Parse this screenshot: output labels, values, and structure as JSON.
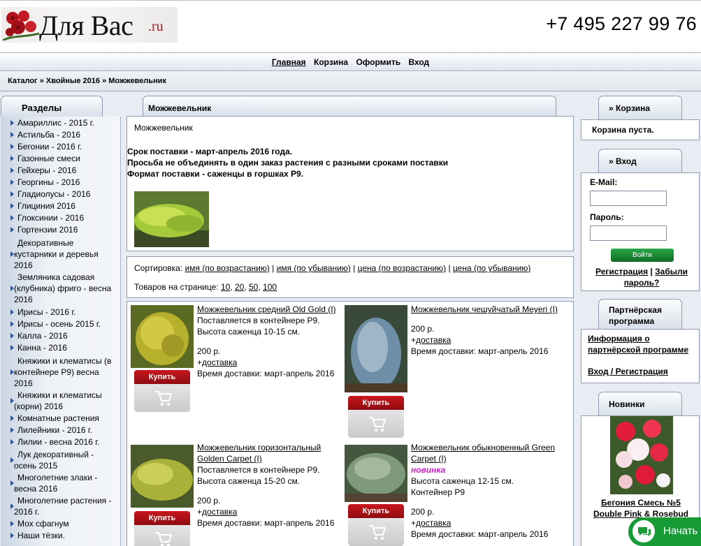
{
  "header": {
    "brand": "Для Вас",
    "tld": ".ru",
    "phone": "+7 495 227 99 76"
  },
  "nav": {
    "items": [
      "Главная",
      "Корзина",
      "Оформить",
      "Вход"
    ]
  },
  "breadcrumb": {
    "items": [
      "Каталог",
      "Хвойные 2016",
      "Можжевельник"
    ],
    "sep": "»"
  },
  "sidebar": {
    "title": "Разделы",
    "items": [
      "Амариллис - 2015 г.",
      "Астильба - 2016",
      "Бегонии - 2016 г.",
      "Газонные смеси",
      "Гейхеры - 2016",
      "Георгины - 2016",
      "Гладиолусы - 2016",
      "Глициния 2016",
      "Глоксинии - 2016",
      "Гортензии 2016",
      "Декоративные кустарники и деревья 2016",
      "Земляника садовая (клубника) фриго - весна 2016",
      "Ирисы - 2016 г.",
      "Ирисы - осень 2015 г.",
      "Калла - 2016",
      "Канна - 2016",
      "Княжики и клематисы (в контейнере Р9) весна 2016",
      "Княжики и клематисы (корни) 2016",
      "Комнатные растения",
      "Лилейники - 2016 г.",
      "Лилии - весна 2016 г.",
      "Лук декоративный - осень 2015",
      "Многолетние злаки - весна 2016",
      "Многолетние растения - 2016 г.",
      "Мох сфагнум",
      "Наши тёзки."
    ]
  },
  "category": {
    "title": "Можжевельник",
    "subtitle": "Можжевельник",
    "notes": [
      "Срок поставки - март-апрель 2016 года.",
      "Просьба не объединять в один заказ растения с разными сроками поставки",
      "Формат поставки - саженцы в горшках Р9."
    ]
  },
  "sort": {
    "label": "Сортировка:",
    "options": [
      "имя (по возрастанию)",
      "имя (по убыванию)",
      "цена (по возрастанию)",
      "цена (по убыванию)"
    ],
    "perpage_label": "Товаров на странице:",
    "perpage": [
      "10",
      "20",
      "50",
      "100"
    ]
  },
  "products": [
    {
      "title": "Можжевельник средний Old Gold (I)",
      "lines": [
        "Поставляется в контейнере Р9.",
        "Высота саженца 10-15 см."
      ],
      "price": "200 р.",
      "delivery_link": "доставка",
      "delivery_time": "Время доставки:  март-апрель 2016",
      "buy": "Купить"
    },
    {
      "title": "Можжевельник чешуйчатый Meyeri (I)",
      "lines": [],
      "price": "200 р.",
      "delivery_link": "доставка",
      "delivery_time": "Время доставки:  март-апрель 2016",
      "buy": "Купить"
    },
    {
      "title": "Можжевельник горизонтальный Golden Carpet (I)",
      "lines": [
        "Поставляется в контейнере Р9.",
        "Высота саженца 15-20 см."
      ],
      "price": "200 р.",
      "delivery_link": "доставка",
      "delivery_time": "Время доставки:  март-апрель 2016",
      "buy": "Купить"
    },
    {
      "title": "Можжевельник обыкновенный Green Carpet (I)",
      "badge": "новинка",
      "lines": [
        "Высота саженца 12-15 см.",
        "Контейнер Р9"
      ],
      "price": "200 р.",
      "delivery_link": "доставка",
      "delivery_time": "Время доставки:  март-апрель 2016",
      "buy": "Купить"
    }
  ],
  "cart": {
    "title": "» Корзина",
    "text": "Корзина пуста."
  },
  "login": {
    "title": "» Вход",
    "email_label": "E-Mail:",
    "password_label": "Пароль:",
    "submit": "Войти",
    "register": "Регистрация",
    "sep": "|",
    "forgot": "Забыли пароль?"
  },
  "partner": {
    "title": "Партнёрская программа",
    "info": "Информация о партнёрской программе",
    "login": "Вход / Регистрация"
  },
  "news": {
    "title": "Новинки",
    "item": "Бегония Смесь №5 Double Pink & Rosebud"
  },
  "chat": {
    "label": "Начать"
  },
  "colors": {
    "accent_red": "#b0141c",
    "chat_green": "#179b37",
    "nav_bg": "#dfe5ee",
    "link_blue": "#2c55a8",
    "badge_magenta": "#cc22cc"
  }
}
